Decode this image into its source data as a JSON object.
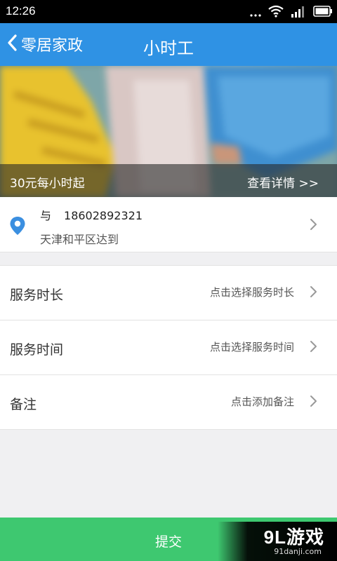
{
  "status_bar": {
    "time": "12:26",
    "icons": [
      "dots-icon",
      "wifi-icon",
      "signal-icon",
      "battery-icon"
    ]
  },
  "header": {
    "back_label": "零居家政",
    "title": "小时工"
  },
  "banner": {
    "price_text": "30元每小时起",
    "detail_link": "查看详情 >>"
  },
  "address": {
    "name": "与",
    "phone": "18602892321",
    "location": "天津和平区达到"
  },
  "options": [
    {
      "label": "服务时长",
      "hint": "点击选择服务时长"
    },
    {
      "label": "服务时间",
      "hint": "点击选择服务时间"
    },
    {
      "label": "备注",
      "hint": "点击添加备注"
    }
  ],
  "submit": {
    "label": "提交"
  },
  "watermark": {
    "brand": "9L游戏",
    "url": "91danji.com"
  },
  "colors": {
    "header": "#2f92e4",
    "submit": "#3ec870",
    "location_pin": "#3b8fe0",
    "background": "#f0f0f2"
  }
}
